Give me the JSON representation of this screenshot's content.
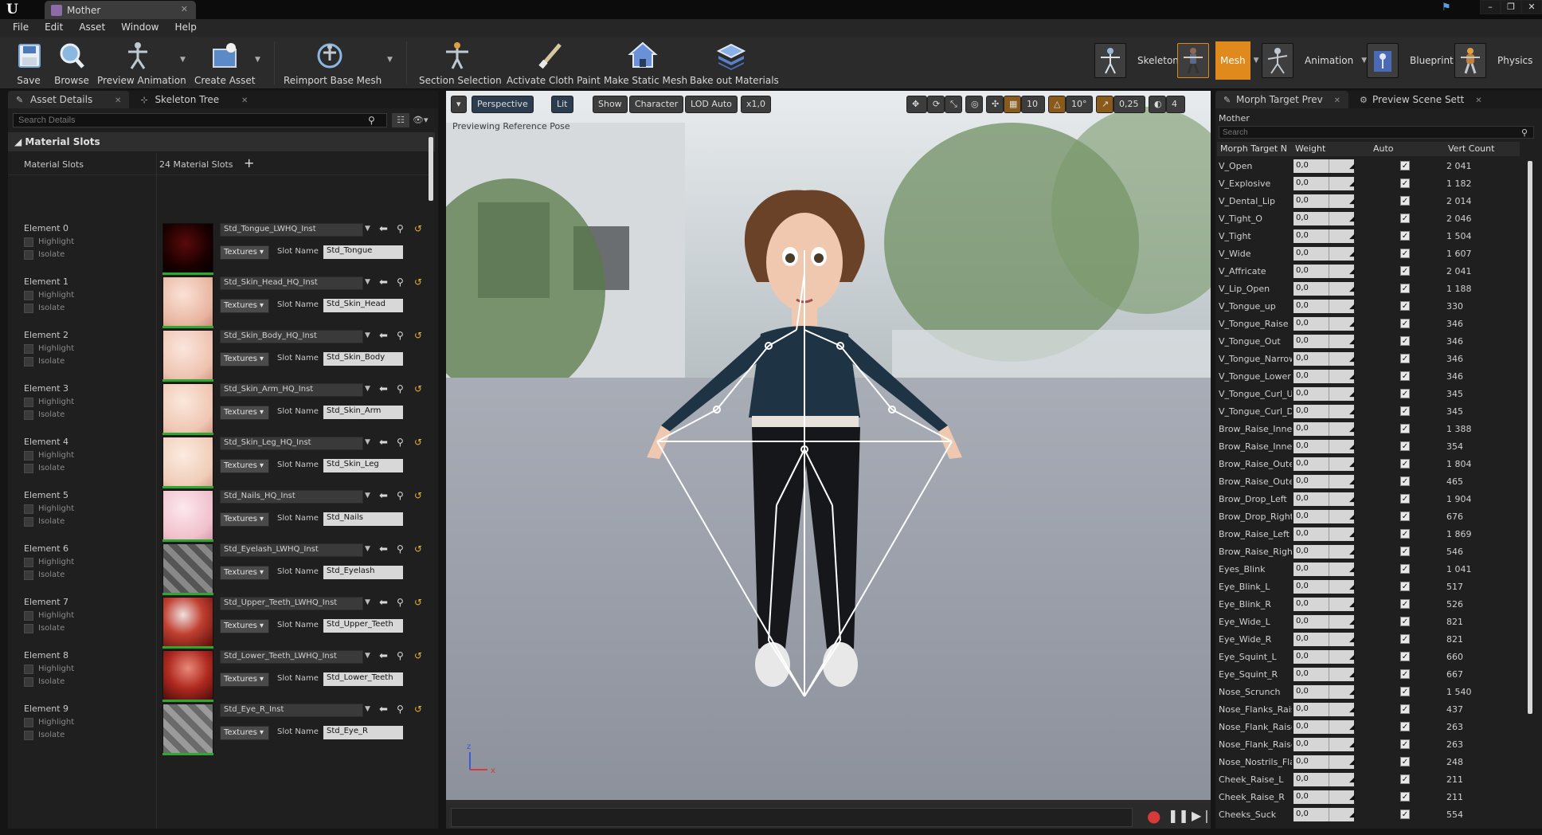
{
  "window": {
    "tab_title": "Mother",
    "logo_text": "U",
    "controls": [
      "–",
      "❐",
      "✕"
    ]
  },
  "menu": [
    "File",
    "Edit",
    "Asset",
    "Window",
    "Help"
  ],
  "toolbar": {
    "buttons": [
      {
        "label": "Save",
        "icon": "save-icon"
      },
      {
        "label": "Browse",
        "icon": "browse-icon"
      },
      {
        "label": "Preview Animation",
        "icon": "preview-animation-icon"
      },
      {
        "label": "Create Asset",
        "icon": "create-asset-icon"
      },
      {
        "label": "Reimport Base Mesh",
        "icon": "reimport-icon"
      },
      {
        "label": "Section Selection",
        "icon": "section-selection-icon"
      },
      {
        "label": "Activate Cloth Paint",
        "icon": "cloth-paint-icon"
      },
      {
        "label": "Make Static Mesh",
        "icon": "static-mesh-icon"
      },
      {
        "label": "Bake out Materials",
        "icon": "bake-materials-icon"
      }
    ],
    "modes": [
      {
        "label": "Skeleton",
        "active": false
      },
      {
        "label": "Mesh",
        "active": true
      },
      {
        "label": "Animation",
        "active": false
      },
      {
        "label": "Blueprint",
        "active": false
      },
      {
        "label": "Physics",
        "active": false
      }
    ]
  },
  "left_panel": {
    "tabs": [
      "Asset Details",
      "Skeleton Tree"
    ],
    "search_placeholder": "Search Details",
    "section_title": "Material Slots",
    "material_slots_label": "Material Slots",
    "material_slots_count": "24 Material Slots",
    "highlight_label": "Highlight",
    "isolate_label": "Isolate",
    "textures_label": "Textures",
    "slot_name_label": "Slot Name",
    "elements": [
      {
        "name": "Element 0",
        "material": "Std_Tongue_LWHQ_Inst",
        "slot": "Std_Tongue"
      },
      {
        "name": "Element 1",
        "material": "Std_Skin_Head_HQ_Inst",
        "slot": "Std_Skin_Head"
      },
      {
        "name": "Element 2",
        "material": "Std_Skin_Body_HQ_Inst",
        "slot": "Std_Skin_Body"
      },
      {
        "name": "Element 3",
        "material": "Std_Skin_Arm_HQ_Inst",
        "slot": "Std_Skin_Arm"
      },
      {
        "name": "Element 4",
        "material": "Std_Skin_Leg_HQ_Inst",
        "slot": "Std_Skin_Leg"
      },
      {
        "name": "Element 5",
        "material": "Std_Nails_HQ_Inst",
        "slot": "Std_Nails"
      },
      {
        "name": "Element 6",
        "material": "Std_Eyelash_LWHQ_Inst",
        "slot": "Std_Eyelash"
      },
      {
        "name": "Element 7",
        "material": "Std_Upper_Teeth_LWHQ_Inst",
        "slot": "Std_Upper_Teeth"
      },
      {
        "name": "Element 8",
        "material": "Std_Lower_Teeth_LWHQ_Inst",
        "slot": "Std_Lower_Teeth"
      },
      {
        "name": "Element 9",
        "material": "Std_Eye_R_Inst",
        "slot": "Std_Eye_R"
      }
    ]
  },
  "viewport": {
    "buttons": [
      "▾",
      "Perspective",
      "Lit",
      "Show",
      "Character",
      "LOD Auto",
      "x1,0"
    ],
    "right_values": [
      "10",
      "10°",
      "0,25",
      "4"
    ],
    "preview_text": "Previewing Reference Pose"
  },
  "right_panel": {
    "tabs": [
      "Morph Target Prev",
      "Preview Scene Sett"
    ],
    "owner": "Mother",
    "search_placeholder": "Search",
    "columns": [
      "Morph Target N",
      "Weight",
      "Auto",
      "Vert Count"
    ],
    "rows": [
      {
        "name": "V_Open",
        "weight": "0,0",
        "verts": "2 041"
      },
      {
        "name": "V_Explosive",
        "weight": "0,0",
        "verts": "1 182"
      },
      {
        "name": "V_Dental_Lip",
        "weight": "0,0",
        "verts": "2 014"
      },
      {
        "name": "V_Tight_O",
        "weight": "0,0",
        "verts": "2 046"
      },
      {
        "name": "V_Tight",
        "weight": "0,0",
        "verts": "1 504"
      },
      {
        "name": "V_Wide",
        "weight": "0,0",
        "verts": "1 607"
      },
      {
        "name": "V_Affricate",
        "weight": "0,0",
        "verts": "2 041"
      },
      {
        "name": "V_Lip_Open",
        "weight": "0,0",
        "verts": "1 188"
      },
      {
        "name": "V_Tongue_up",
        "weight": "0,0",
        "verts": "330"
      },
      {
        "name": "V_Tongue_Raise",
        "weight": "0,0",
        "verts": "346"
      },
      {
        "name": "V_Tongue_Out",
        "weight": "0,0",
        "verts": "346"
      },
      {
        "name": "V_Tongue_Narrow",
        "weight": "0,0",
        "verts": "346"
      },
      {
        "name": "V_Tongue_Lower",
        "weight": "0,0",
        "verts": "346"
      },
      {
        "name": "V_Tongue_Curl_U",
        "weight": "0,0",
        "verts": "345"
      },
      {
        "name": "V_Tongue_Curl_D",
        "weight": "0,0",
        "verts": "345"
      },
      {
        "name": "Brow_Raise_Inner",
        "weight": "0,0",
        "verts": "1 388"
      },
      {
        "name": "Brow_Raise_Inner",
        "weight": "0,0",
        "verts": "354"
      },
      {
        "name": "Brow_Raise_Outer",
        "weight": "0,0",
        "verts": "1 804"
      },
      {
        "name": "Brow_Raise_Outer",
        "weight": "0,0",
        "verts": "465"
      },
      {
        "name": "Brow_Drop_Left",
        "weight": "0,0",
        "verts": "1 904"
      },
      {
        "name": "Brow_Drop_Right",
        "weight": "0,0",
        "verts": "676"
      },
      {
        "name": "Brow_Raise_Left",
        "weight": "0,0",
        "verts": "1 869"
      },
      {
        "name": "Brow_Raise_Right",
        "weight": "0,0",
        "verts": "546"
      },
      {
        "name": "Eyes_Blink",
        "weight": "0,0",
        "verts": "1 041"
      },
      {
        "name": "Eye_Blink_L",
        "weight": "0,0",
        "verts": "517"
      },
      {
        "name": "Eye_Blink_R",
        "weight": "0,0",
        "verts": "526"
      },
      {
        "name": "Eye_Wide_L",
        "weight": "0,0",
        "verts": "821"
      },
      {
        "name": "Eye_Wide_R",
        "weight": "0,0",
        "verts": "821"
      },
      {
        "name": "Eye_Squint_L",
        "weight": "0,0",
        "verts": "660"
      },
      {
        "name": "Eye_Squint_R",
        "weight": "0,0",
        "verts": "667"
      },
      {
        "name": "Nose_Scrunch",
        "weight": "0,0",
        "verts": "1 540"
      },
      {
        "name": "Nose_Flanks_Raise",
        "weight": "0,0",
        "verts": "437"
      },
      {
        "name": "Nose_Flank_Raise",
        "weight": "0,0",
        "verts": "263"
      },
      {
        "name": "Nose_Flank_Raise",
        "weight": "0,0",
        "verts": "263"
      },
      {
        "name": "Nose_Nostrils_Flare",
        "weight": "0,0",
        "verts": "248"
      },
      {
        "name": "Cheek_Raise_L",
        "weight": "0,0",
        "verts": "211"
      },
      {
        "name": "Cheek_Raise_R",
        "weight": "0,0",
        "verts": "211"
      },
      {
        "name": "Cheeks_Suck",
        "weight": "0,0",
        "verts": "554"
      }
    ]
  },
  "colors": {
    "accent": "#e08a1e",
    "panel": "#1f1f1f",
    "thumb_ok": "#2fa82f"
  }
}
